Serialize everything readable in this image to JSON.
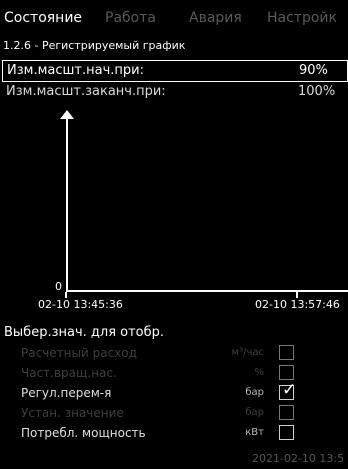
{
  "tabs": [
    "Состояние",
    "Работа",
    "Авария",
    "Настройк"
  ],
  "breadcrumb": "1.2.6 - Регистрируемый график",
  "scale_rows": [
    {
      "label": "Изм.масшт.нач.при:",
      "value": "90%"
    },
    {
      "label": "Изм.масшт.заканч.при:",
      "value": "100%"
    }
  ],
  "chart": {
    "y_zero": "0",
    "x_start": "02-10 13:45:36",
    "x_end": "02-10 13:57:46"
  },
  "display_section": {
    "title": "Выбер.знач. для отобр.",
    "params": [
      {
        "label": "Расчетный расход",
        "unit": "м³/час",
        "checked": false,
        "enabled": false
      },
      {
        "label": "Част.вращ.нас.",
        "unit": "%",
        "checked": false,
        "enabled": false
      },
      {
        "label": "Регул.перем-я",
        "unit": "бар",
        "checked": true,
        "enabled": true
      },
      {
        "label": "Устан. значение",
        "unit": "бар",
        "checked": false,
        "enabled": false
      },
      {
        "label": "Потребл. мощность",
        "unit": "кВт",
        "checked": false,
        "enabled": true
      }
    ]
  },
  "status_clock": "2021-02-10 13:5",
  "icons": {
    "checkmark": "checkmark-icon",
    "axis_arrow": "arrow-up-icon"
  }
}
